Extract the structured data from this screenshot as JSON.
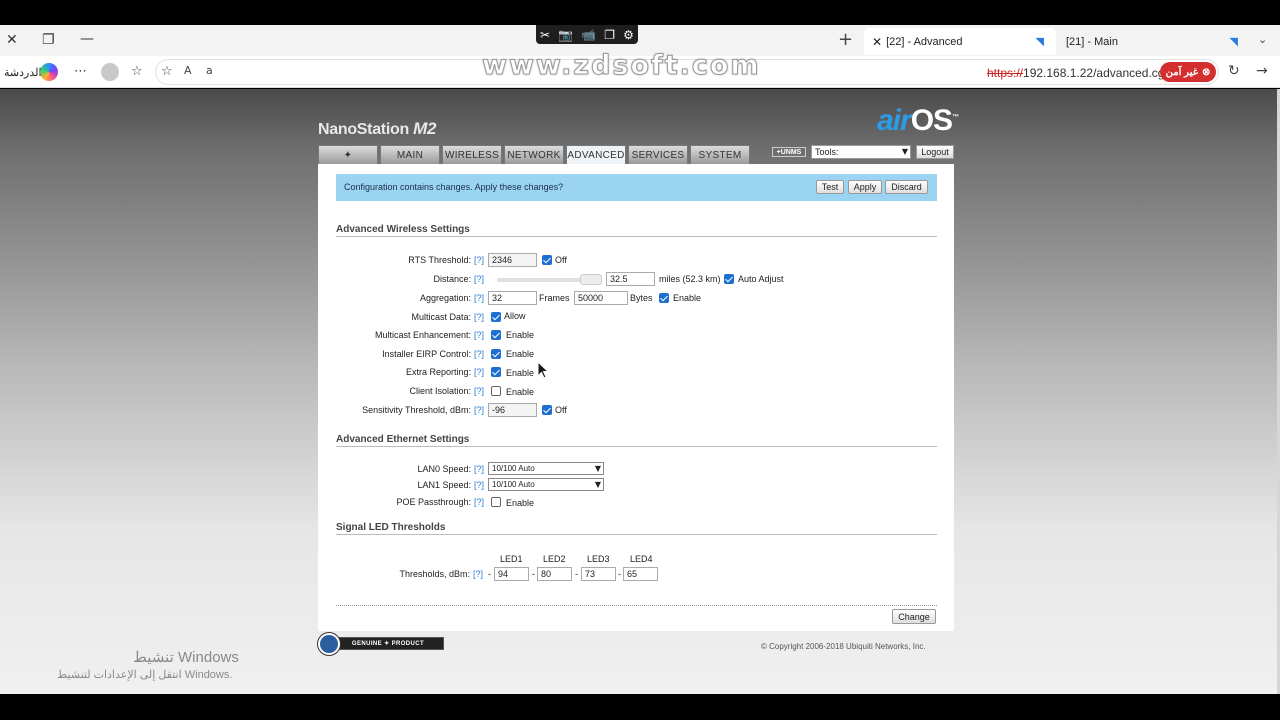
{
  "browser": {
    "capture_toolbar": [
      "✂",
      "📷",
      "📹",
      "❐",
      "⚙"
    ],
    "tabs": [
      {
        "label": "[22] - Advanced"
      },
      {
        "label": "[21] - Main"
      }
    ],
    "copilot_label": "الدردشة",
    "url_scheme": "https://",
    "url_rest": "192.168.1.22/advanced.cgi",
    "not_secure": "غير آمن",
    "watermark": "www.zdsoft.com"
  },
  "header": {
    "device_name": "NanoStation",
    "device_model": "M2",
    "brand_air": "air",
    "brand_os": "OS",
    "brand_tm": "™"
  },
  "nav": {
    "tabs": [
      "MAIN",
      "WIRELESS",
      "NETWORK",
      "ADVANCED",
      "SERVICES",
      "SYSTEM"
    ],
    "active": "ADVANCED",
    "unms": "+UNMS",
    "tools": "Tools:",
    "logout": "Logout"
  },
  "notice": {
    "text": "Configuration contains changes. Apply these changes?",
    "test": "Test",
    "apply": "Apply",
    "discard": "Discard"
  },
  "wireless": {
    "title": "Advanced Wireless Settings",
    "help": "[?]",
    "rts": {
      "label": "RTS Threshold:",
      "value": "2346",
      "off_label": "Off",
      "off": true
    },
    "distance": {
      "label": "Distance:",
      "value": "32.5",
      "unit": "miles (52.3 km)",
      "auto_label": "Auto Adjust",
      "auto": true
    },
    "aggregation": {
      "label": "Aggregation:",
      "frames": "32",
      "frames_unit": "Frames",
      "bytes": "50000",
      "bytes_unit": "Bytes",
      "enable_label": "Enable",
      "enable": true
    },
    "multicast_data": {
      "label": "Multicast Data:",
      "opt": "Allow",
      "checked": true
    },
    "multicast_enh": {
      "label": "Multicast Enhancement:",
      "opt": "Enable",
      "checked": true
    },
    "installer_eirp": {
      "label": "Installer EIRP Control:",
      "opt": "Enable",
      "checked": true
    },
    "extra_reporting": {
      "label": "Extra Reporting:",
      "opt": "Enable",
      "checked": true
    },
    "client_isolation": {
      "label": "Client Isolation:",
      "opt": "Enable",
      "checked": false
    },
    "sensitivity": {
      "label": "Sensitivity Threshold, dBm:",
      "value": "-96",
      "off_label": "Off",
      "off": true
    }
  },
  "ethernet": {
    "title": "Advanced Ethernet Settings",
    "lan0": {
      "label": "LAN0 Speed:",
      "value": "10/100 Auto"
    },
    "lan1": {
      "label": "LAN1 Speed:",
      "value": "10/100 Auto"
    },
    "poe": {
      "label": "POE Passthrough:",
      "opt": "Enable",
      "checked": false
    }
  },
  "led": {
    "title": "Signal LED Thresholds",
    "label": "Thresholds, dBm:",
    "headers": [
      "LED1",
      "LED2",
      "LED3",
      "LED4"
    ],
    "values": [
      "94",
      "80",
      "73",
      "65"
    ]
  },
  "footer": {
    "change": "Change",
    "genuine": "GENUINE ✦ PRODUCT",
    "copyright": "© Copyright 2006-2018 Ubiquiti Networks, Inc."
  },
  "windows": {
    "activate_title": "تنشيط Windows",
    "activate_sub": "انتقل إلى الإعدادات لتنشيط Windows."
  }
}
